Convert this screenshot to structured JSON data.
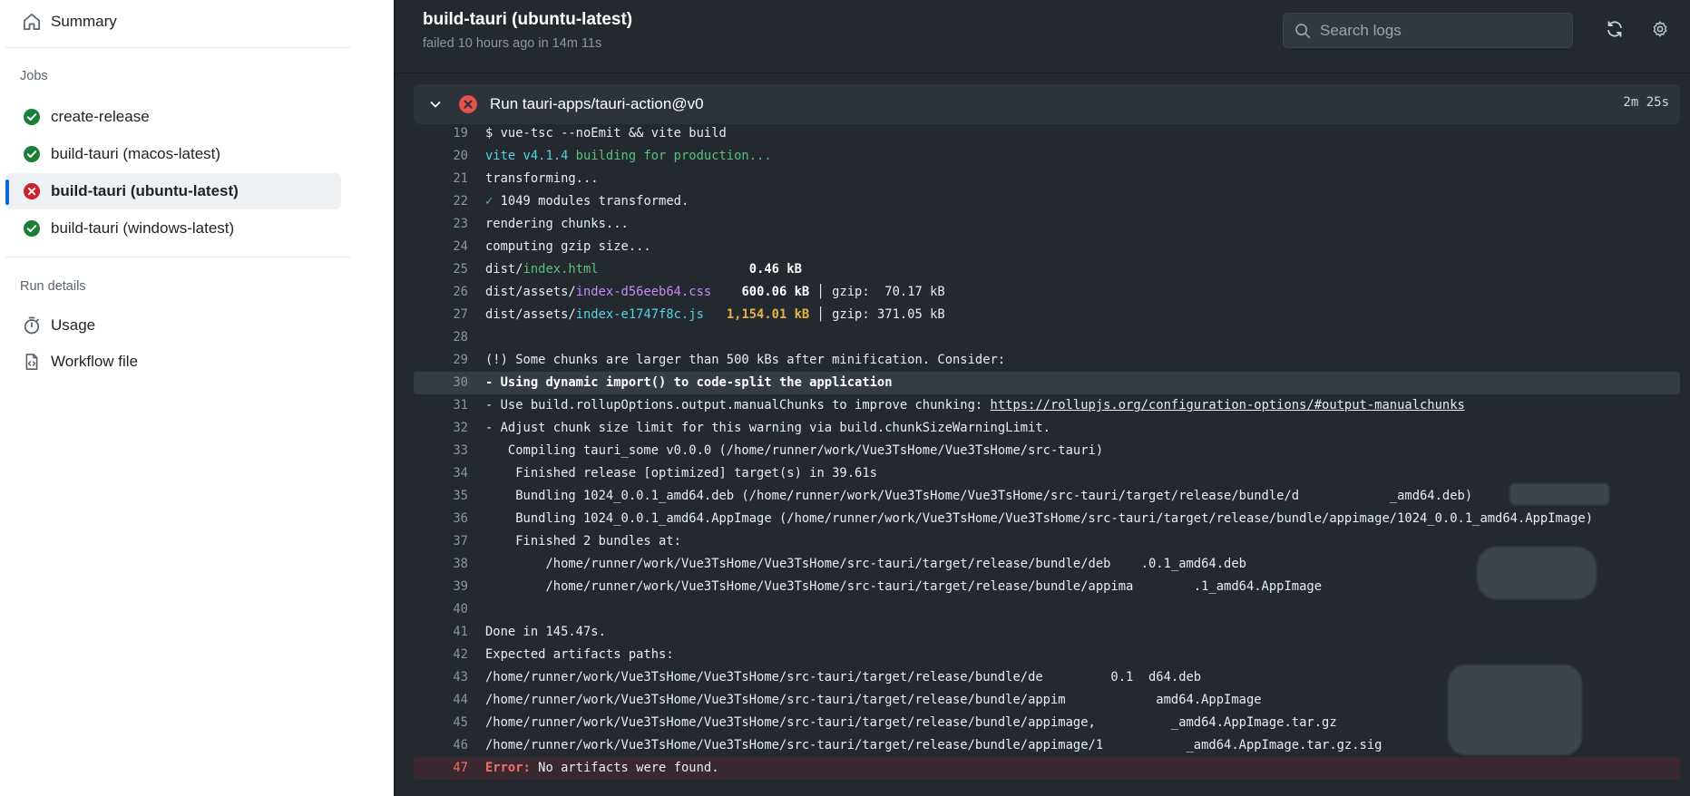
{
  "sidebar": {
    "summary_label": "Summary",
    "jobs_heading": "Jobs",
    "jobs": [
      {
        "label": "create-release",
        "status": "success"
      },
      {
        "label": "build-tauri (macos-latest)",
        "status": "success"
      },
      {
        "label": "build-tauri (ubuntu-latest)",
        "status": "failure"
      },
      {
        "label": "build-tauri (windows-latest)",
        "status": "success"
      }
    ],
    "run_details_heading": "Run details",
    "usage_label": "Usage",
    "workflow_file_label": "Workflow file"
  },
  "header": {
    "title": "build-tauri (ubuntu-latest)",
    "subtitle": "failed 10 hours ago in 14m 11s",
    "search_placeholder": "Search logs"
  },
  "step": {
    "name": "Run tauri-apps/tauri-action@v0",
    "duration": "2m 25s"
  },
  "log": {
    "l19": {
      "num": "19",
      "text": "$ vue-tsc --noEmit && vite build"
    },
    "l20": {
      "num": "20",
      "a": "vite v4.1.4",
      "b": " building for production..."
    },
    "l21": {
      "num": "21",
      "text": "transforming..."
    },
    "l22": {
      "num": "22",
      "a": "✓",
      "b": " 1049 modules transformed."
    },
    "l23": {
      "num": "23",
      "text": "rendering chunks..."
    },
    "l24": {
      "num": "24",
      "text": "computing gzip size..."
    },
    "l25": {
      "num": "25",
      "a": "dist/",
      "b": "index.html",
      "c": "                    ",
      "d": "0.46 kB"
    },
    "l26": {
      "num": "26",
      "a": "dist/assets/",
      "b": "index-d56eeb64.css",
      "c": "    ",
      "d": "600.06 kB",
      "e": " │ gzip:  70.17 kB"
    },
    "l27": {
      "num": "27",
      "a": "dist/assets/",
      "b": "index-e1747f8c.js",
      "c": "   ",
      "d": "1,154.01 kB",
      "e": " │ gzip: 371.05 kB"
    },
    "l28": {
      "num": "28",
      "text": ""
    },
    "l29": {
      "num": "29",
      "text": "(!) Some chunks are larger than 500 kBs after minification. Consider:"
    },
    "l30": {
      "num": "30",
      "text": "- Using dynamic import() to code-split the application"
    },
    "l31": {
      "num": "31",
      "a": "- Use build.rollupOptions.output.manualChunks to improve chunking: ",
      "b": "https://rollupjs.org/configuration-options/#output-manualchunks"
    },
    "l32": {
      "num": "32",
      "text": "- Adjust chunk size limit for this warning via build.chunkSizeWarningLimit."
    },
    "l33": {
      "num": "33",
      "text": "   Compiling tauri_some v0.0.0 (/home/runner/work/Vue3TsHome/Vue3TsHome/src-tauri)"
    },
    "l34": {
      "num": "34",
      "text": "    Finished release [optimized] target(s) in 39.61s"
    },
    "l35": {
      "num": "35",
      "text": "    Bundling 1024_0.0.1_amd64.deb (/home/runner/work/Vue3TsHome/Vue3TsHome/src-tauri/target/release/bundle/d            _amd64.deb)"
    },
    "l36": {
      "num": "36",
      "text": "    Bundling 1024_0.0.1_amd64.AppImage (/home/runner/work/Vue3TsHome/Vue3TsHome/src-tauri/target/release/bundle/appimage/1024_0.0.1_amd64.AppImage)"
    },
    "l37": {
      "num": "37",
      "text": "    Finished 2 bundles at:"
    },
    "l38": {
      "num": "38",
      "text": "        /home/runner/work/Vue3TsHome/Vue3TsHome/src-tauri/target/release/bundle/deb    .0.1_amd64.deb"
    },
    "l39": {
      "num": "39",
      "text": "        /home/runner/work/Vue3TsHome/Vue3TsHome/src-tauri/target/release/bundle/appima        .1_amd64.AppImage"
    },
    "l40": {
      "num": "40",
      "text": ""
    },
    "l41": {
      "num": "41",
      "text": "Done in 145.47s."
    },
    "l42": {
      "num": "42",
      "text": "Expected artifacts paths:"
    },
    "l43": {
      "num": "43",
      "text": "/home/runner/work/Vue3TsHome/Vue3TsHome/src-tauri/target/release/bundle/de         0.1  d64.deb"
    },
    "l44": {
      "num": "44",
      "text": "/home/runner/work/Vue3TsHome/Vue3TsHome/src-tauri/target/release/bundle/appim            amd64.AppImage"
    },
    "l45": {
      "num": "45",
      "text": "/home/runner/work/Vue3TsHome/Vue3TsHome/src-tauri/target/release/bundle/appimage,          _amd64.AppImage.tar.gz"
    },
    "l46": {
      "num": "46",
      "text": "/home/runner/work/Vue3TsHome/Vue3TsHome/src-tauri/target/release/bundle/appimage/1           _amd64.AppImage.tar.gz.sig"
    },
    "l47": {
      "num": "47",
      "a": "Error:",
      "b": " No artifacts were found."
    }
  },
  "colors": {
    "success": "#1a7f37",
    "failure": "#cf222e",
    "accent": "#0969da",
    "log_bg": "#24292f"
  },
  "icons": {
    "summary": "home-icon",
    "success": "check-circle-icon",
    "failure": "x-circle-icon",
    "usage": "stopwatch-icon",
    "workflow": "file-code-icon",
    "search": "search-icon",
    "refresh": "refresh-icon",
    "settings": "gear-icon",
    "collapse": "chevron-down-icon"
  }
}
